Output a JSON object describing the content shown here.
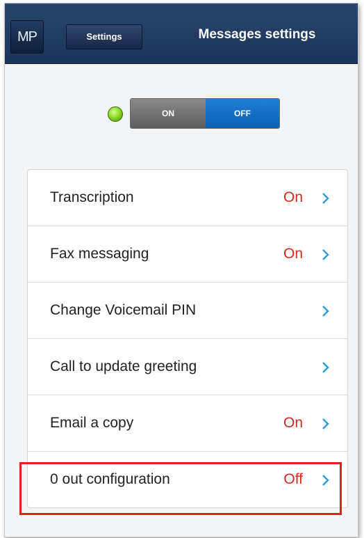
{
  "header": {
    "logo": "MP",
    "back_label": "Settings",
    "title": "Messages settings"
  },
  "toggle": {
    "on_label": "ON",
    "off_label": "OFF",
    "state": "off"
  },
  "list": {
    "rows": [
      {
        "label": "Transcription",
        "value": "On"
      },
      {
        "label": "Fax messaging",
        "value": "On"
      },
      {
        "label": "Change Voicemail PIN",
        "value": ""
      },
      {
        "label": "Call to update greeting",
        "value": ""
      },
      {
        "label": "Email a copy",
        "value": "On"
      },
      {
        "label": "0 out configuration",
        "value": "Off"
      }
    ]
  },
  "colors": {
    "header": "#1b3358",
    "accent_value": "#d42a1e",
    "chevron": "#2a9ad8",
    "highlight": "#e02020",
    "toggle_off": "#0b5fb4",
    "led": "#7fd01a"
  },
  "icons": [
    "chevron-right-icon",
    "status-led-icon",
    "back-arrow-icon"
  ]
}
